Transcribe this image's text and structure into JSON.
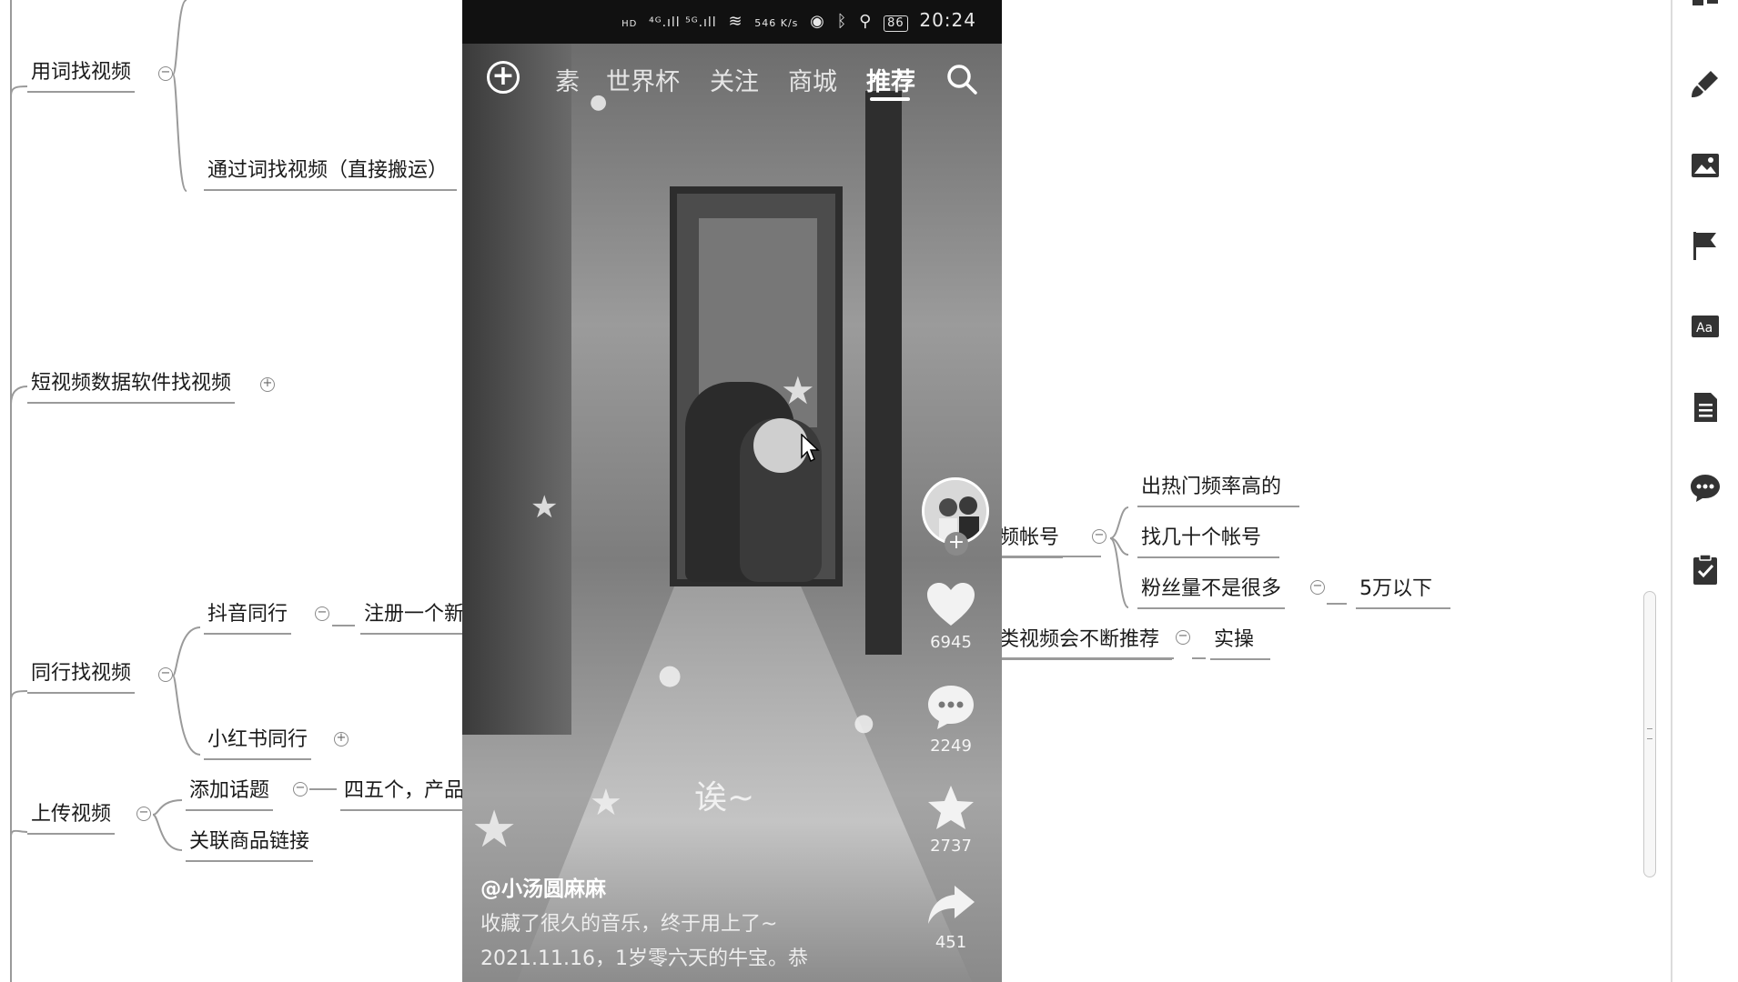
{
  "mindmap": {
    "nodes": {
      "find_by_words": "用词找视频",
      "find_by_words_direct": "通过词找视频（直接搬运）",
      "data_software": "短视频数据软件找视频",
      "peer_find": "同行找视频",
      "douyin_peers": "抖音同行",
      "register_new": "注册一个新",
      "xiaohongshu_peers": "小红书同行",
      "upload_video": "上传视频",
      "add_topic": "添加话题",
      "four_five": "四五个，产品",
      "link_goods": "关联商品链接",
      "account_partial": "频帐号",
      "hot_rate": "出热门频率高的",
      "several_accounts": "找几十个帐号",
      "few_fans": "粉丝量不是很多",
      "under_50k": "5万以下",
      "recommend_partial": "类视频会不断推荐",
      "practice": "实操"
    }
  },
  "phone": {
    "status": {
      "hd1": "HD",
      "hd2": "HD",
      "signal": "⁴ᴳ.ıll ⁵ᴳ.ıll",
      "speed": "546 K/s",
      "battery": "86",
      "time": "20:24"
    },
    "nav": {
      "tabs": [
        "素",
        "世界杯",
        "关注",
        "商城",
        "推荐"
      ],
      "active_tab": "推荐"
    },
    "actions": {
      "likes": "6945",
      "comments": "2249",
      "favorites": "2737",
      "shares": "451"
    },
    "overlay_text": "诶~",
    "author": "@小汤圆麻麻",
    "description": "收藏了很久的音乐，终于用上了~ 2021.11.16，1岁零六天的牛宝。恭"
  },
  "toolbar": {
    "icons": [
      "layout-icon",
      "brush-icon",
      "image-icon",
      "flag-icon",
      "text-style-icon",
      "document-icon",
      "comment-icon",
      "clipboard-icon"
    ]
  }
}
